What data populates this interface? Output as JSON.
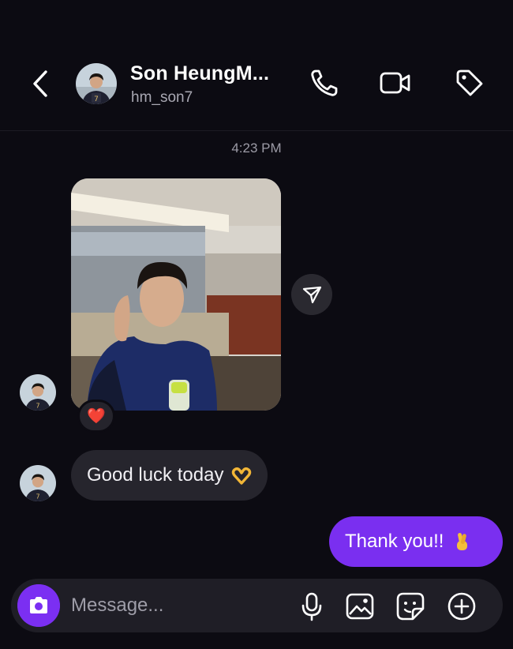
{
  "colors": {
    "background": "#0c0b12",
    "accent": "#7a2ff0",
    "bubble_incoming": "#26252d"
  },
  "header": {
    "back_icon": "chevron-left-icon",
    "title": "Son HeungM...",
    "subtitle": "hm_son7",
    "actions": [
      "phone-icon",
      "video-camera-icon",
      "tag-icon"
    ]
  },
  "conversation": {
    "timestamp": "4:23 PM",
    "photo_message": {
      "description": "selfie-photo",
      "reaction": "❤️"
    },
    "incoming_text": "Good luck today",
    "incoming_emoji": "heart-hands-icon",
    "outgoing_text": "Thank you!!",
    "outgoing_emoji": "crossed-fingers-icon"
  },
  "composer": {
    "placeholder": "Message...",
    "icons": [
      "camera-icon",
      "microphone-icon",
      "image-icon",
      "sticker-icon",
      "plus-circle-icon"
    ]
  }
}
